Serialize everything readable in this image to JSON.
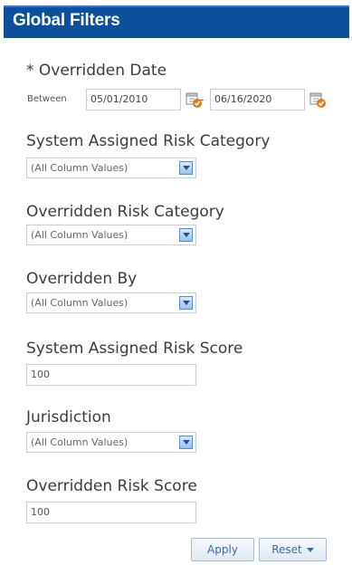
{
  "header": {
    "title": "Global Filters"
  },
  "overridden_date": {
    "label": "* Overridden Date",
    "between_label": "Between",
    "from": "05/01/2010",
    "separator": "-",
    "to": "06/16/2020"
  },
  "system_risk_category": {
    "label": "System Assigned Risk Category",
    "value": "(All Column Values)"
  },
  "overridden_risk_category": {
    "label": "Overridden Risk Category",
    "value": "(All Column Values)"
  },
  "overridden_by": {
    "label": "Overridden By",
    "value": "(All Column Values)"
  },
  "system_risk_score": {
    "label": "System Assigned Risk Score",
    "value": "100"
  },
  "jurisdiction": {
    "label": "Jurisdiction",
    "value": "(All Column Values)"
  },
  "overridden_risk_score": {
    "label": "Overridden Risk Score",
    "value": "100"
  },
  "buttons": {
    "apply": "Apply",
    "reset": "Reset"
  },
  "colors": {
    "header_bg": "#0c4f9a",
    "button_text": "#3d6aa0"
  },
  "icons": {
    "calendar": "calendar-icon",
    "dropdown": "chevron-down-icon"
  }
}
